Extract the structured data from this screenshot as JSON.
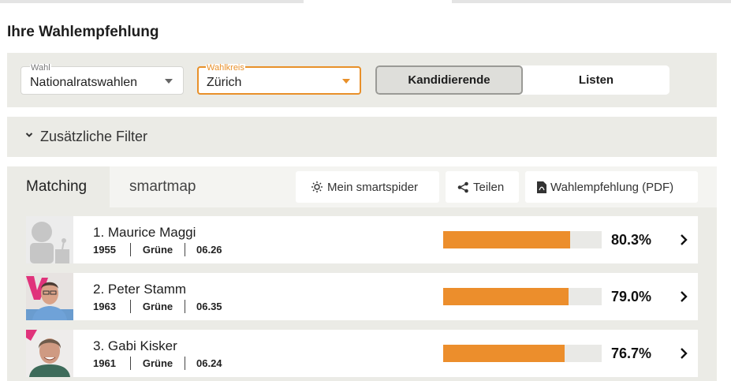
{
  "page_title": "Ihre Wahlempfehlung",
  "selectors": {
    "wahl": {
      "label": "Wahl",
      "value": "Nationalratswahlen"
    },
    "wahlkreis": {
      "label": "Wahlkreis",
      "value": "Zürich"
    }
  },
  "toggle": {
    "active": "Kandidierende",
    "inactive": "Listen"
  },
  "filter": {
    "label": "Zusätzliche Filter"
  },
  "tabs": {
    "matching": "Matching",
    "smartmap": "smartmap"
  },
  "actions": {
    "spider": "Mein smartspider",
    "share": "Teilen",
    "pdf": "Wahlempfehlung (PDF)"
  },
  "candidates": [
    {
      "name": "1. Maurice Maggi",
      "year": "1955",
      "party": "Grüne",
      "code": "06.26",
      "match_pct": "80.3%",
      "match_value": 80.3
    },
    {
      "name": "2. Peter Stamm",
      "year": "1963",
      "party": "Grüne",
      "code": "06.35",
      "match_pct": "79.0%",
      "match_value": 79.0
    },
    {
      "name": "3. Gabi Kisker",
      "year": "1961",
      "party": "Grüne",
      "code": "06.24",
      "match_pct": "76.7%",
      "match_value": 76.7
    }
  ],
  "colors": {
    "accent": "#ec8e2c",
    "panel": "#ebebe6"
  }
}
